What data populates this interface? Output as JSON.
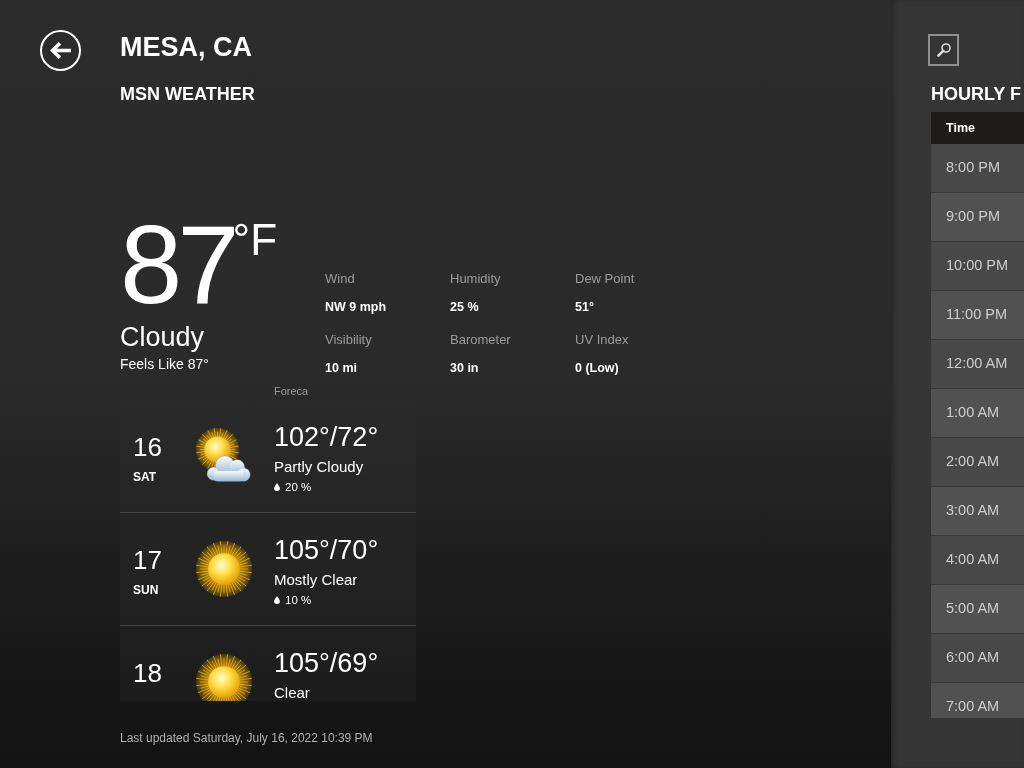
{
  "header": {
    "title": "MESA, CA",
    "subtitle": "MSN WEATHER"
  },
  "current": {
    "temperature": "87",
    "unit": "°F",
    "condition": "Cloudy",
    "feels_like": "Feels Like 87°",
    "details": [
      {
        "label": "Wind",
        "value": "NW 9 mph"
      },
      {
        "label": "Humidity",
        "value": "25 %"
      },
      {
        "label": "Dew Point",
        "value": "51°"
      },
      {
        "label": "Visibility",
        "value": "10 mi"
      },
      {
        "label": "Barometer",
        "value": "30 in"
      },
      {
        "label": "UV Index",
        "value": "0 (Low)"
      }
    ]
  },
  "forecast": {
    "provider": "Foreca",
    "days": [
      {
        "date": "16",
        "day": "SAT",
        "kind": "partly-cloudy",
        "temps": "102°/72°",
        "condition": "Partly Cloudy",
        "precip": "20 %"
      },
      {
        "date": "17",
        "day": "SUN",
        "kind": "sunny",
        "temps": "105°/70°",
        "condition": "Mostly Clear",
        "precip": "10 %"
      },
      {
        "date": "18",
        "kind": "sunny",
        "temps": "105°/69°",
        "condition": "Clear"
      }
    ]
  },
  "last_updated": "Last updated Saturday, July 16, 2022 10:39 PM",
  "hourly": {
    "title": "HOURLY F",
    "columns": [
      "Time"
    ],
    "rows": [
      "8:00 PM",
      "9:00 PM",
      "10:00 PM",
      "11:00 PM",
      "12:00 AM",
      "1:00 AM",
      "2:00 AM",
      "3:00 AM",
      "4:00 AM",
      "5:00 AM",
      "6:00 AM",
      "7:00 AM"
    ]
  }
}
